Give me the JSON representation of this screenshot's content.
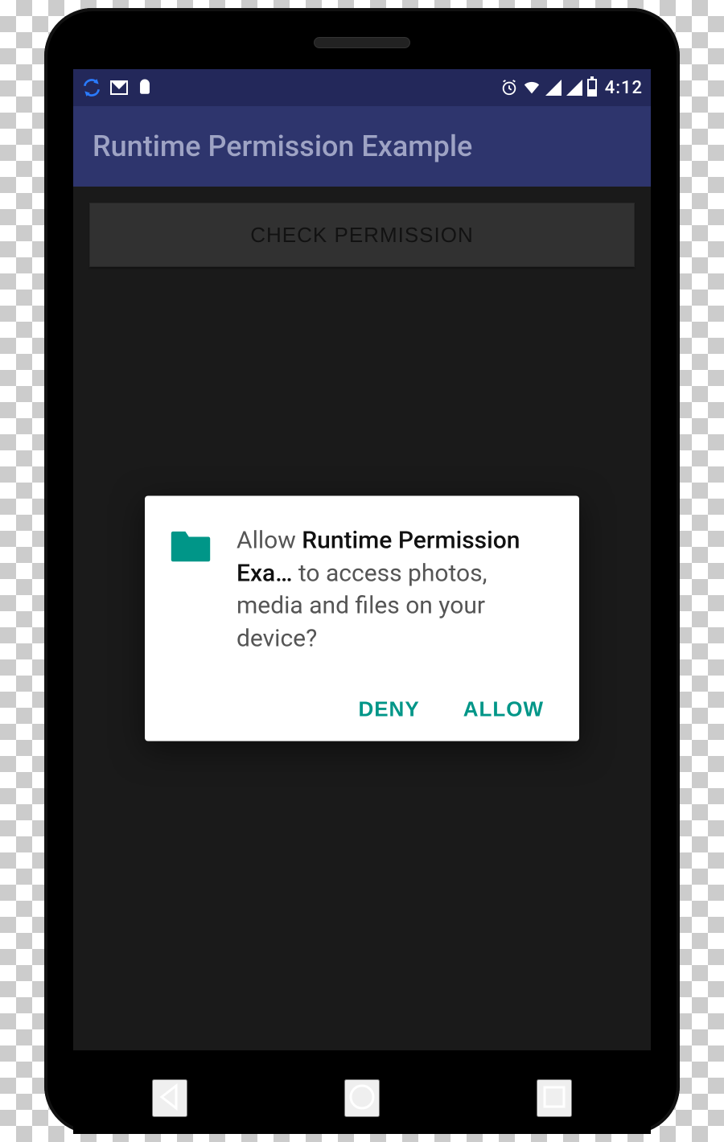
{
  "status": {
    "time": "4:12"
  },
  "appbar": {
    "title": "Runtime Permission Example"
  },
  "main": {
    "check_button": "CHECK PERMISSION"
  },
  "dialog": {
    "text_prefix": "Allow ",
    "app_name": "Runtime Permission Exa…",
    "text_suffix": " to access photos, media and files on your device?",
    "deny_label": "DENY",
    "allow_label": "ALLOW",
    "accent_color": "#009688"
  },
  "icons": {
    "sync": "sync-icon",
    "gmail": "gmail-icon",
    "android": "android-icon",
    "alarm": "alarm-icon",
    "wifi": "wifi-icon",
    "signal": "signal-icon",
    "battery": "battery-icon",
    "folder": "folder-icon",
    "nav_back": "back-icon",
    "nav_home": "home-icon",
    "nav_recent": "recent-icon"
  }
}
